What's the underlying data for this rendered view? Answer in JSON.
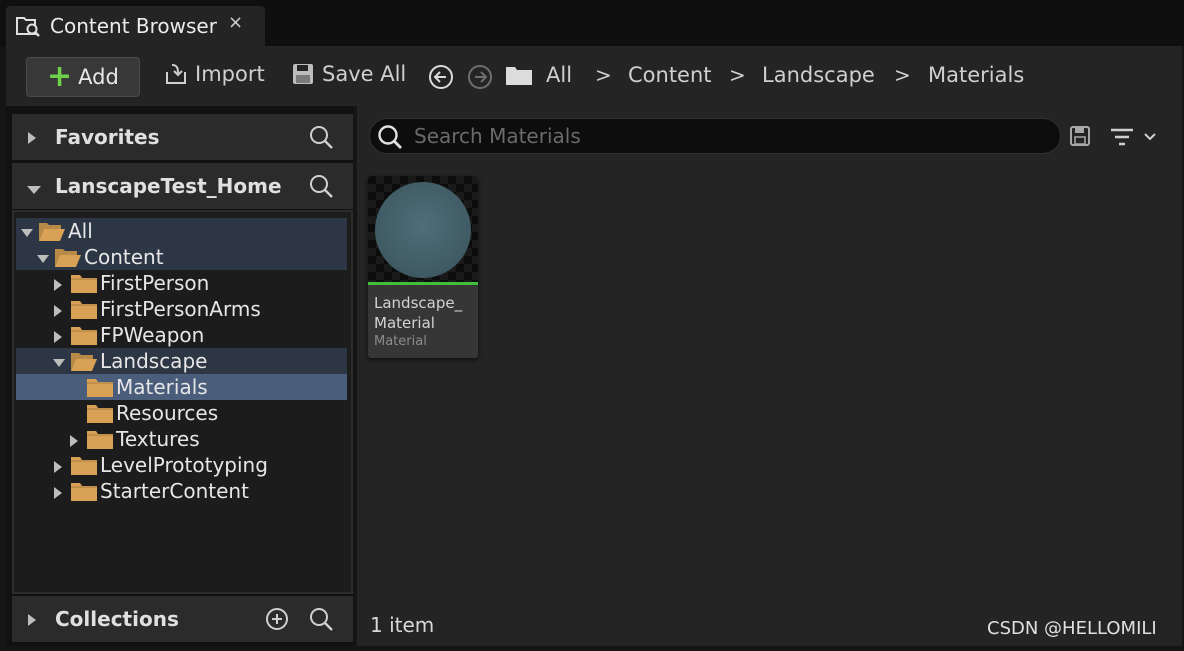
{
  "tab": {
    "title": "Content Browser",
    "close": "×",
    "icon": "content-browser-icon"
  },
  "toolbar": {
    "add_label": "Add",
    "import_label": "Import",
    "save_all_label": "Save All",
    "breadcrumbs": [
      "All",
      "Content",
      "Landscape",
      "Materials"
    ],
    "separator": ">"
  },
  "left": {
    "favorites_label": "Favorites",
    "home_label": "LanscapeTest_Home",
    "collections_label": "Collections",
    "tree": [
      {
        "label": "All",
        "depth": 0,
        "expander": "open",
        "folder": "open",
        "state": "hl"
      },
      {
        "label": "Content",
        "depth": 1,
        "expander": "open",
        "folder": "open",
        "state": "hl"
      },
      {
        "label": "FirstPerson",
        "depth": 2,
        "expander": "closed",
        "folder": "closed",
        "state": ""
      },
      {
        "label": "FirstPersonArms",
        "depth": 2,
        "expander": "closed",
        "folder": "closed",
        "state": ""
      },
      {
        "label": "FPWeapon",
        "depth": 2,
        "expander": "closed",
        "folder": "closed",
        "state": ""
      },
      {
        "label": "Landscape",
        "depth": 2,
        "expander": "open",
        "folder": "open",
        "state": "hl"
      },
      {
        "label": "Materials",
        "depth": 3,
        "expander": "none",
        "folder": "closed",
        "state": "sel"
      },
      {
        "label": "Resources",
        "depth": 3,
        "expander": "none",
        "folder": "closed",
        "state": ""
      },
      {
        "label": "Textures",
        "depth": 3,
        "expander": "closed",
        "folder": "closed",
        "state": ""
      },
      {
        "label": "LevelPrototyping",
        "depth": 2,
        "expander": "closed",
        "folder": "closed",
        "state": ""
      },
      {
        "label": "StarterContent",
        "depth": 2,
        "expander": "closed",
        "folder": "closed",
        "state": ""
      }
    ]
  },
  "right": {
    "search_placeholder": "Search Materials",
    "assets": [
      {
        "name": "Landscape_ Material",
        "type": "Material"
      }
    ],
    "item_count": "1 item"
  },
  "watermark": "CSDN @HELLOMILI",
  "colors": {
    "accent_green": "#6fd14a",
    "asset_bar": "#3fbf3a",
    "selection": "#4a5e7c",
    "folder": "#d9a155"
  }
}
